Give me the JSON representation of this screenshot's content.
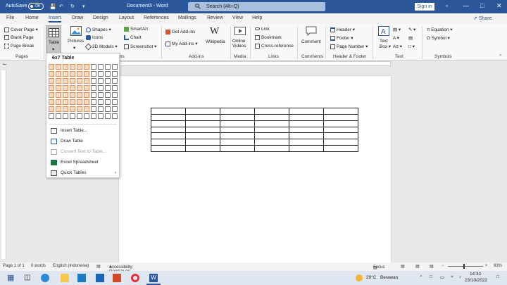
{
  "titlebar": {
    "autosave": "AutoSave",
    "toggle": "Off",
    "doc": "Document3",
    "separator": "-",
    "app": "Word",
    "search": "Search (Alt+Q)",
    "signin": "Sign in",
    "min": "—",
    "max": "□",
    "close": "✕"
  },
  "tabs": [
    "File",
    "Home",
    "Insert",
    "Draw",
    "Design",
    "Layout",
    "References",
    "Mailings",
    "Review",
    "View",
    "Help"
  ],
  "share": "Share",
  "ribbon": {
    "pages": [
      "Cover Page",
      "Blank Page",
      "Page Break"
    ],
    "table": "Table",
    "pictures": "Pictures",
    "illus": [
      "Shapes",
      "Icons",
      "3D Models"
    ],
    "illus2": [
      "SmartArt",
      "Chart",
      "Screenshot"
    ],
    "addins": [
      "Get Add-ins",
      "My Add-ins"
    ],
    "wikipedia": "Wikipedia",
    "online": [
      "Online",
      "Videos"
    ],
    "links": [
      "Link",
      "Bookmark",
      "Cross-reference"
    ],
    "comment": "Comment",
    "hf": [
      "Header",
      "Footer",
      "Page Number"
    ],
    "textbox": [
      "Text",
      "Box"
    ],
    "symbols": [
      "Equation",
      "Symbol"
    ],
    "groups": {
      "pages": "Pages",
      "ns": "ns",
      "addins": "Add-ins",
      "media": "Media",
      "links": "Links",
      "comments": "Comments",
      "hf": "Header & Footer",
      "text": "Text",
      "symbols": "Symbols"
    }
  },
  "popup": {
    "title": "6x7 Table",
    "cols": 10,
    "rows": 8,
    "hl_cols": 6,
    "hl_rows": 7,
    "items": [
      {
        "label": "Insert Table...",
        "icon": "insert-table-icon",
        "disabled": false
      },
      {
        "label": "Draw Table",
        "icon": "draw-table-icon",
        "disabled": false
      },
      {
        "label": "Convert Text to Table...",
        "icon": "convert-icon",
        "disabled": true
      },
      {
        "label": "Excel Spreadsheet",
        "icon": "excel-icon",
        "disabled": false
      },
      {
        "label": "Quick Tables",
        "icon": "quick-tables-icon",
        "disabled": false
      }
    ]
  },
  "doc_table": {
    "rows": 7,
    "cols": 6
  },
  "status": {
    "page": "Page 1 of 1",
    "words": "0 words",
    "lang": "English (Indonesia)",
    "access": "Accessibility: Good to go",
    "focus": "Focus",
    "zoom": "93%"
  },
  "taskbar": {
    "weather": "29°C",
    "weather_desc": "Berawan",
    "time": "14:33",
    "date": "23/10/2022"
  },
  "colors": {
    "accent": "#2b579a",
    "highlight": "#fbd8bf"
  }
}
